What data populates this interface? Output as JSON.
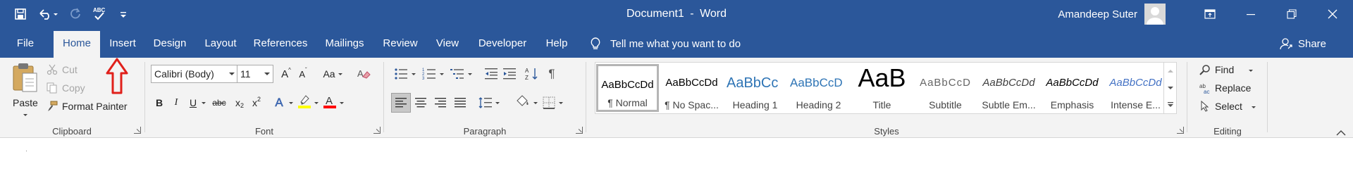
{
  "titlebar": {
    "document_title": "Document1",
    "separator": "-",
    "app_name": "Word",
    "user_name": "Amandeep Suter",
    "bg_color": "#2b579a"
  },
  "quick_access": {
    "icons": [
      "save-icon",
      "undo-icon",
      "redo-icon",
      "spelling-icon",
      "customize-qat-icon"
    ],
    "spelling_text": "ABC"
  },
  "tabs": [
    {
      "label": "File",
      "active": false
    },
    {
      "label": "Home",
      "active": true
    },
    {
      "label": "Insert",
      "active": false
    },
    {
      "label": "Design",
      "active": false
    },
    {
      "label": "Layout",
      "active": false
    },
    {
      "label": "References",
      "active": false
    },
    {
      "label": "Mailings",
      "active": false
    },
    {
      "label": "Review",
      "active": false
    },
    {
      "label": "View",
      "active": false
    },
    {
      "label": "Developer",
      "active": false
    },
    {
      "label": "Help",
      "active": false
    }
  ],
  "tell_me": "Tell me what you want to do",
  "share": "Share",
  "clipboard": {
    "label": "Clipboard",
    "paste": "Paste",
    "cut": "Cut",
    "copy": "Copy",
    "format_painter": "Format Painter"
  },
  "font": {
    "label": "Font",
    "font_name": "Calibri (Body)",
    "font_size": "11",
    "grow": "A",
    "shrink": "A",
    "change_case": "Aa",
    "bold": "B",
    "italic": "I",
    "underline": "U",
    "strike": "abc",
    "subscript": "x",
    "subscript_mark": "2",
    "superscript": "x",
    "superscript_mark": "2",
    "text_effects": "A",
    "font_color": "A",
    "highlight_color": "#ffff00",
    "font_color_value": "#ff0000"
  },
  "paragraph": {
    "label": "Paragraph"
  },
  "styles": {
    "label": "Styles",
    "items": [
      {
        "preview": "AaBbCcDd",
        "name": "¶ Normal",
        "selected": true
      },
      {
        "preview": "AaBbCcDd",
        "name": "¶ No Spac...",
        "selected": false
      },
      {
        "preview": "AaBbCc",
        "name": "Heading 1",
        "selected": false
      },
      {
        "preview": "AaBbCcD",
        "name": "Heading 2",
        "selected": false
      },
      {
        "preview": "AaB",
        "name": "Title",
        "selected": false
      },
      {
        "preview": "AaBbCcD",
        "name": "Subtitle",
        "selected": false
      },
      {
        "preview": "AaBbCcDd",
        "name": "Subtle Em...",
        "selected": false
      },
      {
        "preview": "AaBbCcDd",
        "name": "Emphasis",
        "selected": false
      },
      {
        "preview": "AaBbCcDd",
        "name": "Intense E...",
        "selected": false
      }
    ]
  },
  "editing": {
    "label": "Editing",
    "find": "Find",
    "replace": "Replace",
    "select": "Select"
  },
  "annotation_color": "#e0201b"
}
